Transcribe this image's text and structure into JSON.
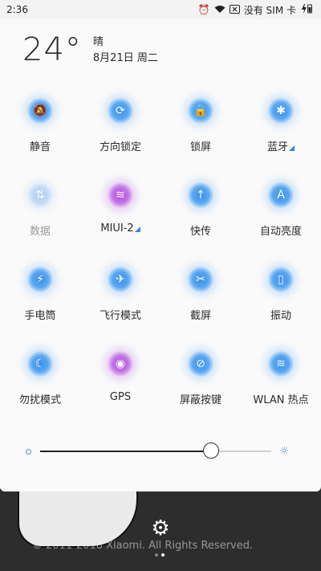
{
  "status_bar": {
    "time": "2:36",
    "carrier_text": "没有 SIM 卡",
    "icons": [
      "alarm-icon",
      "wifi-icon",
      "no-sim-icon",
      "charging-battery-icon"
    ]
  },
  "weather": {
    "temperature": "24°",
    "condition": "晴",
    "date": "8月21日 周二"
  },
  "tiles": [
    {
      "id": "mute",
      "label": "静音",
      "icon": "bell-off-icon",
      "glyph": "🔕",
      "style": "blue",
      "submenu": false
    },
    {
      "id": "rotation-lock",
      "label": "方向锁定",
      "icon": "rotation-lock-icon",
      "glyph": "⟳",
      "style": "blue",
      "submenu": false
    },
    {
      "id": "lock-screen",
      "label": "锁屏",
      "icon": "lock-icon",
      "glyph": "🔒",
      "style": "blue",
      "submenu": false
    },
    {
      "id": "bluetooth",
      "label": "蓝牙",
      "icon": "bluetooth-icon",
      "glyph": "✱",
      "style": "blue",
      "submenu": true
    },
    {
      "id": "data",
      "label": "数据",
      "icon": "mobile-data-icon",
      "glyph": "⇅",
      "style": "dim",
      "submenu": false
    },
    {
      "id": "wifi",
      "label": "MIUI-2",
      "icon": "wifi-icon",
      "glyph": "≋",
      "style": "purple",
      "submenu": true
    },
    {
      "id": "quick-share",
      "label": "快传",
      "icon": "upload-icon",
      "glyph": "↑",
      "style": "blue",
      "submenu": false
    },
    {
      "id": "auto-brightness",
      "label": "自动亮度",
      "icon": "auto-brightness-icon",
      "glyph": "A",
      "style": "blue",
      "submenu": false
    },
    {
      "id": "flashlight",
      "label": "手电筒",
      "icon": "flashlight-icon",
      "glyph": "⚡",
      "style": "blue",
      "submenu": false
    },
    {
      "id": "airplane",
      "label": "飞行模式",
      "icon": "airplane-icon",
      "glyph": "✈",
      "style": "blue",
      "submenu": false
    },
    {
      "id": "screenshot",
      "label": "截屏",
      "icon": "scissors-icon",
      "glyph": "✂",
      "style": "blue",
      "submenu": false
    },
    {
      "id": "vibrate",
      "label": "振动",
      "icon": "vibrate-icon",
      "glyph": "▯",
      "style": "blue",
      "submenu": false
    },
    {
      "id": "dnd",
      "label": "勿扰模式",
      "icon": "moon-icon",
      "glyph": "☾",
      "style": "blue",
      "submenu": false
    },
    {
      "id": "gps",
      "label": "GPS",
      "icon": "location-icon",
      "glyph": "◉",
      "style": "purple",
      "submenu": false
    },
    {
      "id": "block-buttons",
      "label": "屏蔽按键",
      "icon": "block-keys-icon",
      "glyph": "⊘",
      "style": "blue",
      "submenu": false
    },
    {
      "id": "hotspot",
      "label": "WLAN 热点",
      "icon": "hotspot-icon",
      "glyph": "≋",
      "style": "blue",
      "submenu": false
    }
  ],
  "brightness": {
    "level": 0.74
  },
  "bottom": {
    "background_text": "© 2011-2018 Xiaomi. All Rights Reserved.",
    "settings_icon": "gear-icon",
    "page_count": 2,
    "active_page": 1
  },
  "colors": {
    "accent": "#3b82e0",
    "tile_blue": "#3a8fe8",
    "tile_purple": "#b04ad8",
    "panel_bg": "#fafafa",
    "bottom_bg": "#2d2d2d"
  }
}
